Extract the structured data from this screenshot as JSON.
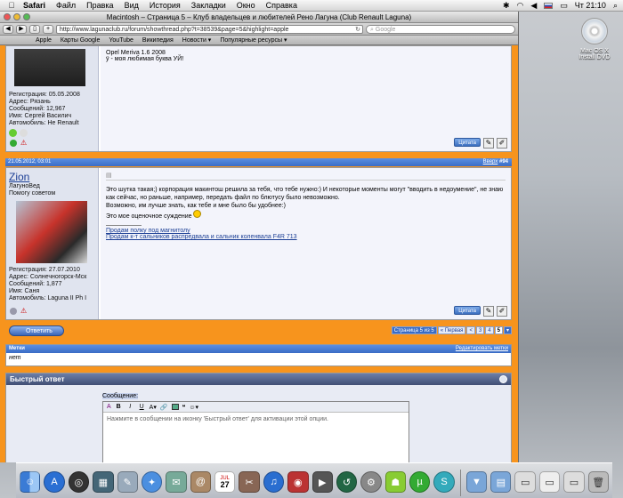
{
  "menubar": {
    "app": "Safari",
    "items": [
      "Файл",
      "Правка",
      "Вид",
      "История",
      "Закладки",
      "Окно",
      "Справка"
    ],
    "clock": "Чт 21:10"
  },
  "desktop": {
    "dvd_label_1": "Mac OS X",
    "dvd_label_2": "Install DVD"
  },
  "window": {
    "title": "Macintosh – Страница 5 – Клуб владельцев и любителей Рено Лагуна (Club Renault Laguna)",
    "url": "http://www.lagunaclub.ru/forum/showthread.php?t=38539&page=5&highlight=apple",
    "search_placeholder": "Google",
    "bookmarks": [
      "Apple",
      "Карты Google",
      "YouTube",
      "Википедия",
      "Новости ▾",
      "Популярные ресурсы ▾"
    ]
  },
  "post1": {
    "text1": "Opel Meriva 1.6 2008",
    "text2": "ÿ - моя любимая буква УЙ!",
    "reg": "Регистрация: 05.05.2008",
    "addr": "Адрес: Рязань",
    "msgs": "Сообщений: 12,967",
    "name": "Имя: Сергей Василич",
    "car": "Автомобиль: Не Renault",
    "quote": "Цитата"
  },
  "post2": {
    "date": "21.05.2012, 03:01",
    "top_link": "Вверх",
    "number": "#94",
    "username": "Zion",
    "rank1": "ЛагуноВед",
    "rank2": "Помогу советом",
    "reg": "Регистрация: 27.07.2010",
    "addr": "Адрес: Солнечногорск-Мск",
    "msgs": "Сообщений: 1,877",
    "name": "Имя: Саня",
    "car": "Автомобиль: Laguna II Ph I",
    "body1": "Это шутка такая;) корпорация макинтош решила за тебя, что тебе нужно:) И некоторые моменты могут \"вводить в недоумение\", не знаю как сейчас, но раньше, например, передать файл по блютусу было невозможно.",
    "body2": "Возможно, им лучше знать, как тебе и мне было бы удобнее:)",
    "body3": "Это мое оценочное суждение",
    "link1": "Продам полку под магнитолу",
    "link2": "Продам к-т сальников распредвала и сальник коленвала F4R 713",
    "quote": "Цитата"
  },
  "nav": {
    "reply": "Ответить",
    "pager_label": "Страница 5 из 5",
    "first": "« Первая",
    "prev": "<",
    "p3": "3",
    "p4": "4",
    "p5": "5"
  },
  "tags": {
    "title": "Метки",
    "edit": "Редактировать метки",
    "value": "нет"
  },
  "quickreply": {
    "title": "Быстрый ответ",
    "label": "Сообщение:",
    "hint": "Нажмите в сообщении на иконку 'Быстрый ответ' для активации этой опции."
  },
  "dock": {
    "calendar_day": "27",
    "calendar_month": "JUL"
  }
}
